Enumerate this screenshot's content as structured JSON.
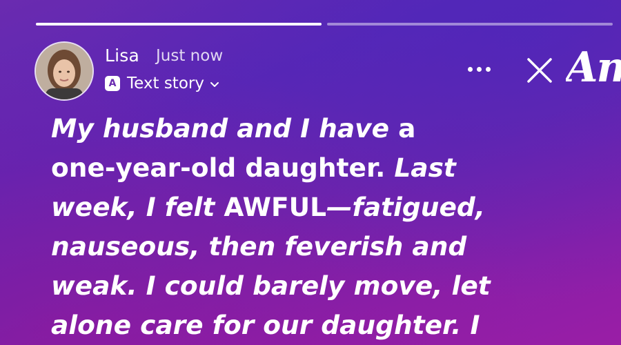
{
  "progress": {
    "segments": [
      {
        "fill": 1.0
      },
      {
        "fill": 0.0
      }
    ]
  },
  "header": {
    "user_name": "Lisa",
    "timestamp": "Just now",
    "story_type_badge": "A",
    "story_type_label": "Text story"
  },
  "brand": {
    "text": "Am"
  },
  "story": {
    "line1_regular": "My husband and I have ",
    "line1_bold": "a",
    "line2_bold": "one-year-old daughter.",
    "line2_regular": " Last",
    "line3_regular_a": "week, I felt ",
    "line3_bold": "AWFUL",
    "line3_regular_b": "—fatigued,",
    "line4": "nauseous, then feverish and",
    "line5": "weak. I could barely move, let",
    "line6": "alone care for our daughter. I"
  },
  "colors": {
    "gradient_start": "#6a2bb0",
    "gradient_end": "#9a1ea6",
    "text": "#ffffff"
  },
  "icons": {
    "more": "more-horizontal-icon",
    "close": "close-icon",
    "chevron": "chevron-down-icon"
  }
}
